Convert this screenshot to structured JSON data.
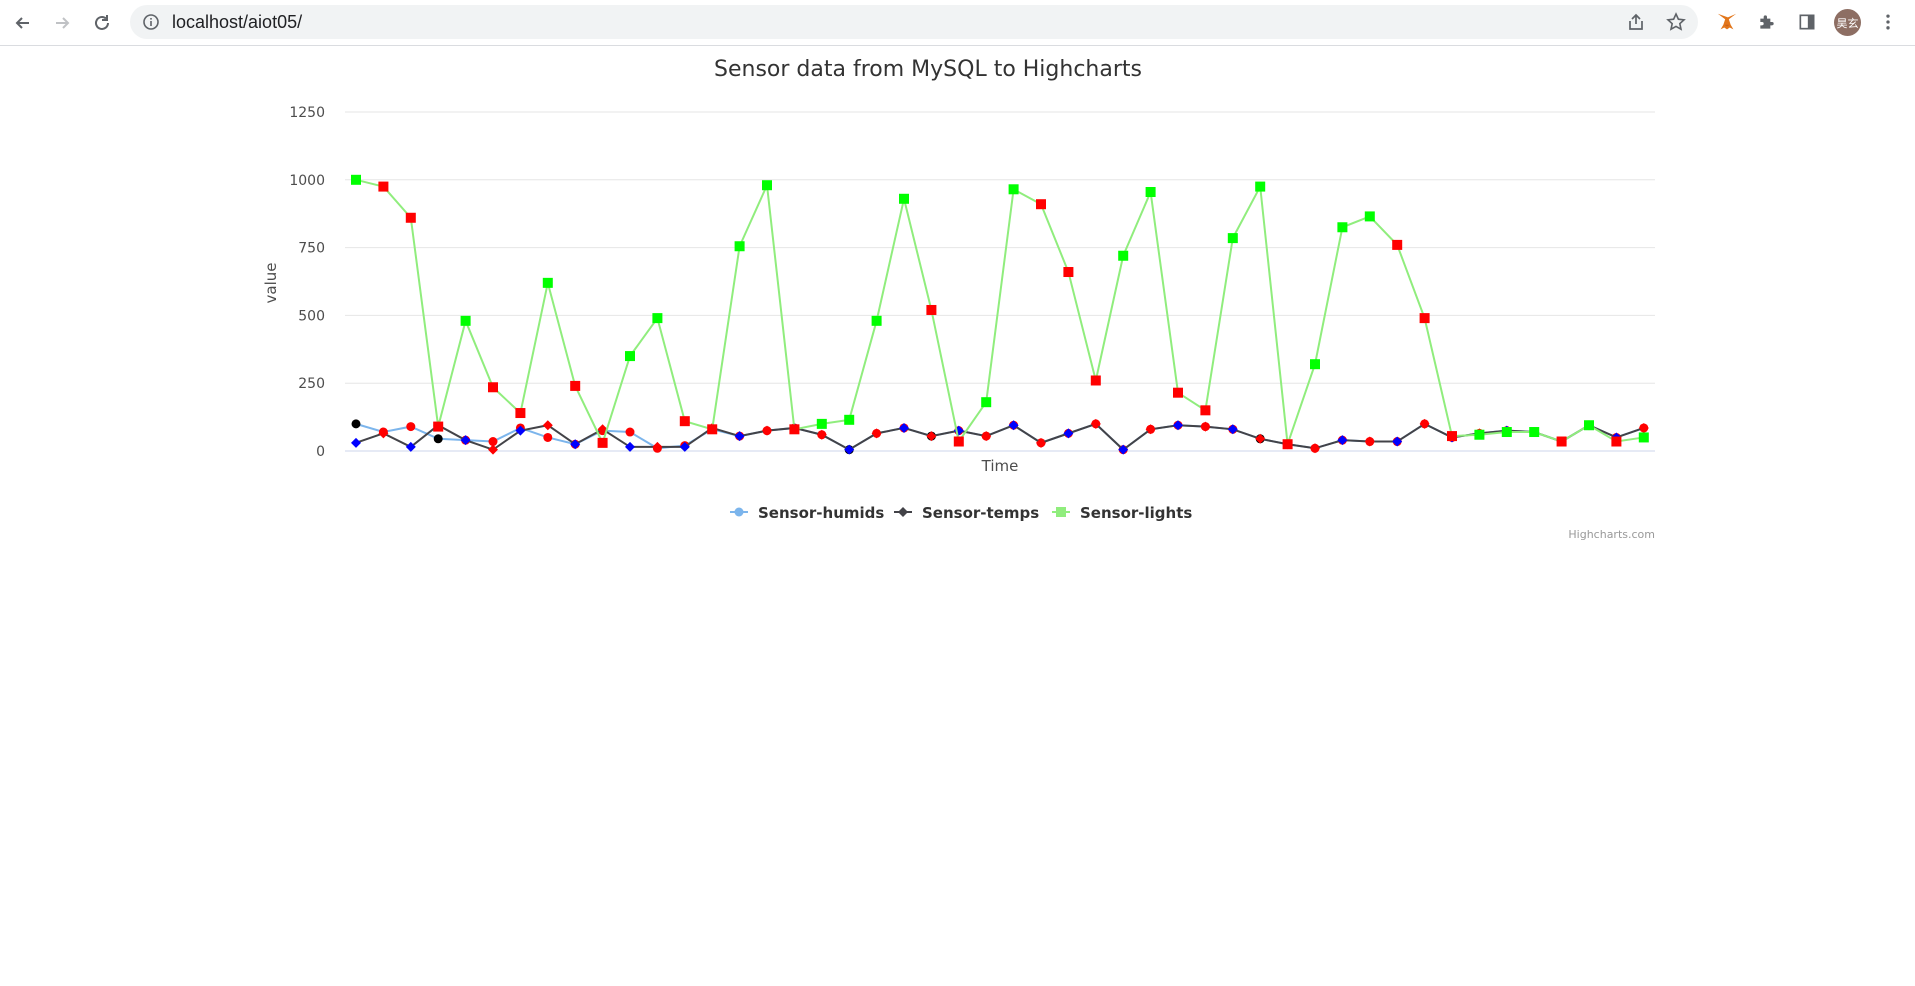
{
  "browser": {
    "url": "localhost/aiot05/",
    "profile_initials": "昊玄"
  },
  "chart_data": {
    "type": "line",
    "title": "Sensor data from MySQL to Highcharts",
    "xlabel": "Time",
    "ylabel": "value",
    "ylim": [
      0,
      1250
    ],
    "yticks": [
      0,
      250,
      500,
      750,
      1000,
      1250
    ],
    "grid": true,
    "legend_position": "bottom-center",
    "credits": "Highcharts.com",
    "point_count": 48,
    "series": [
      {
        "name": "Sensor-humids",
        "color": "#7cb5ec",
        "marker": "circle",
        "values": [
          100,
          70,
          90,
          45,
          40,
          35,
          85,
          50,
          25,
          75,
          70,
          10,
          20,
          80,
          55,
          75,
          85,
          60,
          5,
          65,
          85,
          55,
          75,
          55,
          95,
          30,
          65,
          100,
          5,
          80,
          95,
          90,
          80,
          45,
          25,
          10,
          40,
          35,
          35,
          100,
          50,
          65,
          75,
          70,
          35,
          95,
          50,
          85
        ]
      },
      {
        "name": "Sensor-temps",
        "color": "#434348",
        "marker": "diamond",
        "values": [
          30,
          65,
          15,
          95,
          40,
          5,
          75,
          95,
          25,
          80,
          15,
          15,
          15,
          85,
          55,
          75,
          85,
          60,
          5,
          65,
          85,
          55,
          75,
          55,
          95,
          30,
          65,
          100,
          5,
          80,
          95,
          90,
          80,
          45,
          25,
          10,
          40,
          35,
          35,
          100,
          50,
          65,
          75,
          70,
          35,
          95,
          50,
          85
        ]
      },
      {
        "name": "Sensor-lights",
        "color": "#90ed7d",
        "marker": "square",
        "values": [
          1000,
          975,
          860,
          90,
          480,
          235,
          140,
          620,
          240,
          30,
          350,
          490,
          110,
          80,
          755,
          980,
          80,
          100,
          115,
          480,
          930,
          520,
          35,
          180,
          965,
          910,
          660,
          260,
          720,
          955,
          215,
          150,
          785,
          975,
          25,
          320,
          825,
          865,
          760,
          490,
          55,
          60,
          70,
          70,
          35,
          95,
          35,
          50
        ]
      }
    ]
  }
}
